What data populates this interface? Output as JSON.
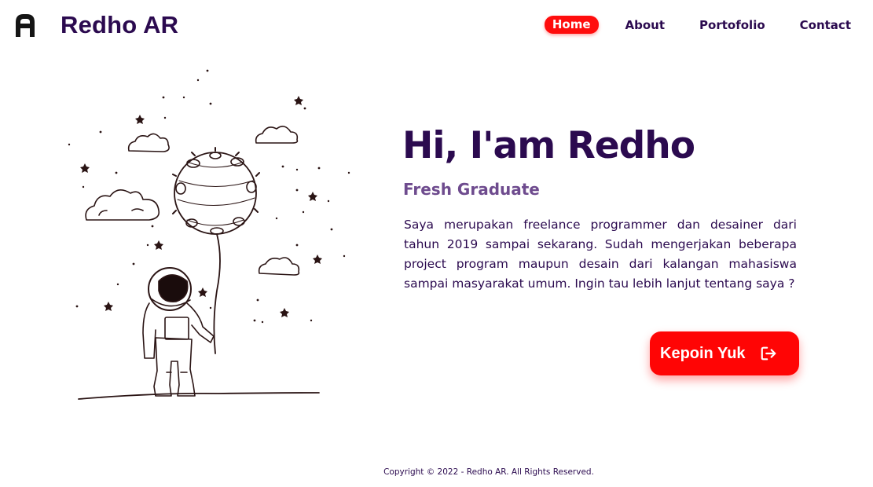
{
  "header": {
    "brand": "Redho AR",
    "logo_icon": "letter-a-logo-icon",
    "nav": {
      "home": "Home",
      "about": "About",
      "portfolio": "Portofolio",
      "contact": "Contact"
    },
    "active_nav": "Home"
  },
  "hero": {
    "title": "Hi, I'am Redho",
    "subtitle": "Fresh Graduate",
    "description": "Saya merupakan freelance programmer dan desainer dari tahun 2019 sampai sekarang. Sudah mengerjakan beberapa project program maupun desain dari kalangan mahasiswa sampai masyarakat umum. Ingin tau lebih lanjut tentang saya ?",
    "cta_label": "Kepoin Yuk",
    "cta_icon": "sign-out-arrow-icon",
    "illustration": "astronaut-with-balloon-illustration"
  },
  "footer": {
    "copyright": "Copyright © 2022 - Redho AR. All Rights Reserved."
  },
  "colors": {
    "primary_text": "#2b0a4f",
    "accent": "#ff0505",
    "subtitle": "#6e4b8e",
    "background": "#ffffff"
  }
}
